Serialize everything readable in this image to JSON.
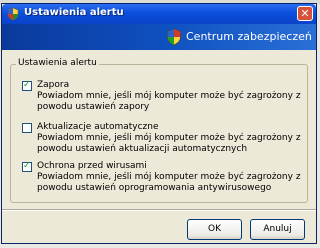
{
  "window": {
    "title": "Ustawienia alertu",
    "close_label": "✕"
  },
  "banner": {
    "text": "Centrum zabezpieczeń"
  },
  "group": {
    "legend": "Ustawienia alertu",
    "options": [
      {
        "label": "Zapora",
        "checked": true,
        "desc": "Powiadom mnie, jeśli mój komputer może być zagrożony z powodu ustawień zapory"
      },
      {
        "label": "Aktualizacje automatyczne",
        "checked": false,
        "desc": "Powiadom mnie, jeśli mój komputer może być zagrożony z powodu ustawień aktualizacji automatycznych"
      },
      {
        "label": "Ochrona przed wirusami",
        "checked": true,
        "desc": "Powiadom mnie, jeśli mój komputer może być zagrożony z powodu ustawień oprogramowania antywirusowego"
      }
    ]
  },
  "buttons": {
    "ok": "OK",
    "cancel": "Anuluj"
  },
  "colors": {
    "title_bar": "#0b4fdc",
    "banner": "#0e4fbf",
    "dialog_bg": "#ece9d8"
  },
  "icons": {
    "title": "security-center-shield-icon",
    "banner": "security-center-shield-icon"
  }
}
